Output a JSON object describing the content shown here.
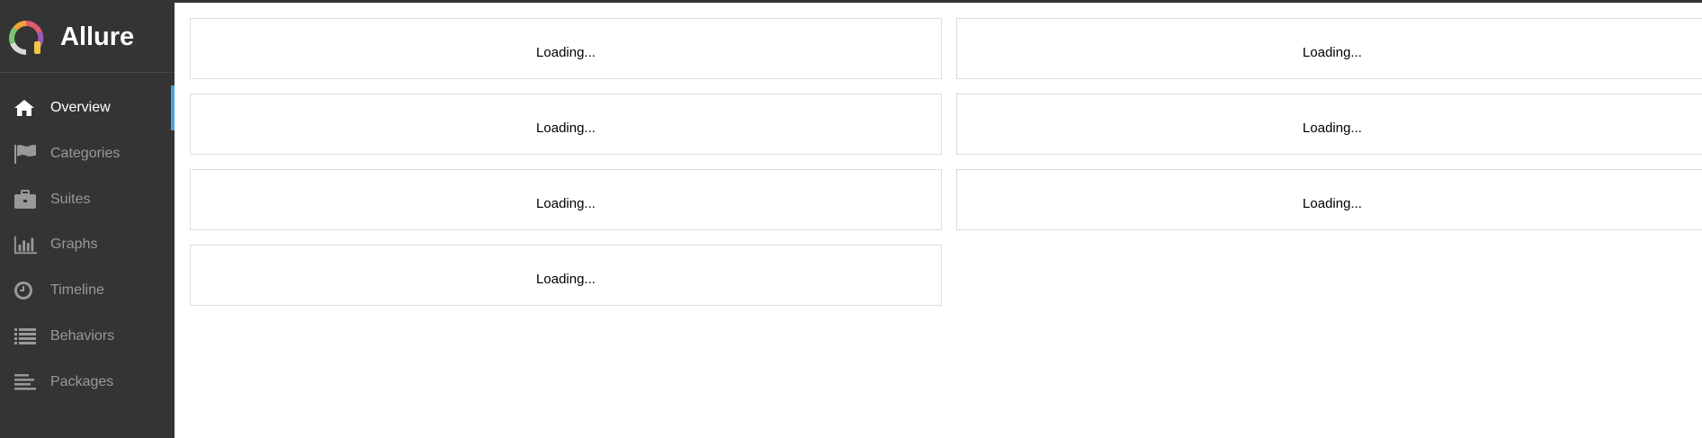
{
  "app": {
    "name": "Allure"
  },
  "sidebar": {
    "items": [
      {
        "label": "Overview",
        "icon": "home-icon",
        "active": true
      },
      {
        "label": "Categories",
        "icon": "flag-icon",
        "active": false
      },
      {
        "label": "Suites",
        "icon": "briefcase-icon",
        "active": false
      },
      {
        "label": "Graphs",
        "icon": "bar-chart-icon",
        "active": false
      },
      {
        "label": "Timeline",
        "icon": "clock-icon",
        "active": false
      },
      {
        "label": "Behaviors",
        "icon": "list-icon",
        "active": false
      },
      {
        "label": "Packages",
        "icon": "align-left-icon",
        "active": false
      }
    ]
  },
  "widgets": [
    {
      "text": "Loading..."
    },
    {
      "text": "Loading..."
    },
    {
      "text": "Loading..."
    },
    {
      "text": "Loading..."
    },
    {
      "text": "Loading..."
    },
    {
      "text": "Loading..."
    },
    {
      "text": "Loading..."
    }
  ],
  "colors": {
    "sidebar_bg": "#343434",
    "active_indicator": "#4aa3df",
    "inactive_text": "#999999"
  }
}
